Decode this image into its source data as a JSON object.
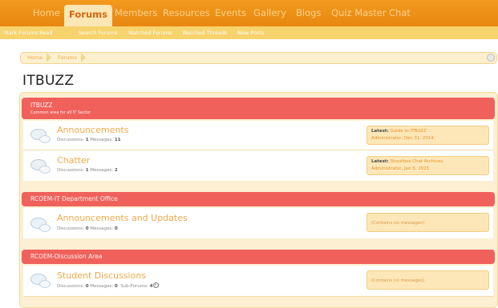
{
  "nav": {
    "tabs": [
      {
        "label": "Home"
      },
      {
        "label": "Forums"
      },
      {
        "label": "Members"
      },
      {
        "label": "Resources"
      },
      {
        "label": "Events"
      },
      {
        "label": "Gallery"
      },
      {
        "label": "Blogs"
      },
      {
        "label": "Quiz Master"
      },
      {
        "label": "Chat"
      }
    ],
    "active": "Forums",
    "sub_links": [
      {
        "label": "Mark Forums Read"
      },
      {
        "label": "Search Forums"
      },
      {
        "label": "Watched Forums"
      },
      {
        "label": "Watched Threads"
      },
      {
        "label": "New Posts"
      }
    ]
  },
  "breadcrumb": [
    "Home",
    "Forums"
  ],
  "page_title": "ITBUZZ",
  "categories": [
    {
      "title": "ITBUZZ",
      "description": "Common area for all IT Sector",
      "forums": [
        {
          "title": "Announcements",
          "stats": {
            "discussions_label": "Discussions:",
            "discussions": "1",
            "messages_label": "Messages:",
            "messages": "11"
          },
          "latest": {
            "label": "Latest:",
            "thread": "Guide to ITBUZZ",
            "by": "Administrator",
            "date": ", Dec 31, 2014"
          }
        },
        {
          "title": "Chatter",
          "stats": {
            "discussions_label": "Discussions:",
            "discussions": "1",
            "messages_label": "Messages:",
            "messages": "2"
          },
          "latest": {
            "label": "Latest:",
            "thread": "Shoutbox Chat Archives",
            "by": "Administrator",
            "date": ", Jan 5, 2015"
          }
        }
      ]
    },
    {
      "title": "RCOEM-IT Department Office",
      "forums": [
        {
          "title": "Announcements and Updates",
          "stats": {
            "discussions_label": "Discussions:",
            "discussions": "0",
            "messages_label": "Messages:",
            "messages": "0"
          },
          "no_messages": "(Contains no messages)"
        }
      ]
    },
    {
      "title": "RCOEM-Discussion Area",
      "forums": [
        {
          "title": "Student Discussions",
          "stats": {
            "discussions_label": "Discussions:",
            "discussions": "0",
            "messages_label": "Messages:",
            "messages": "0",
            "subforums_label": "Sub-Forums:",
            "subforums": "4"
          },
          "no_messages": "(Contains no messages)"
        }
      ]
    }
  ],
  "colors": {
    "nav_orange": "#e98d14",
    "category_red": "#f0615c",
    "link_orange": "#f0a94a"
  }
}
